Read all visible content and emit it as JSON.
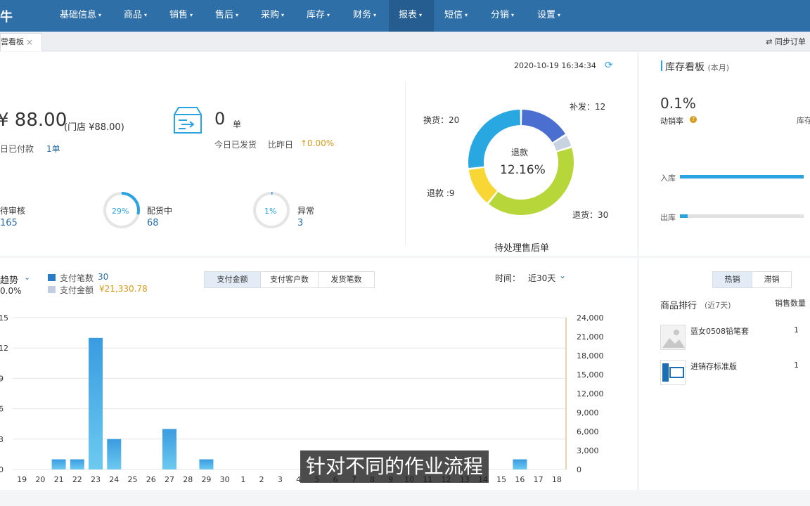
{
  "nav": {
    "logo": "牛",
    "items": [
      "基础信息",
      "商品",
      "销售",
      "售后",
      "采购",
      "库存",
      "财务",
      "报表",
      "短信",
      "分销",
      "设置"
    ],
    "active": "报表"
  },
  "tabbar": {
    "tab_label": "营看板",
    "close": "×",
    "sync_label": "同步订单"
  },
  "overview": {
    "timestamp": "2020-10-19 16:34:34",
    "paid_amount": "¥ 88.00",
    "paid_amount_sub": "(门店 ¥88.00)",
    "paid_today_label": "日已付款",
    "paid_today_count": "1单",
    "shipped_count": "0",
    "shipped_unit": "单",
    "shipped_label": "今日已发货",
    "compare_label": "比昨日",
    "compare_value": "↑0.00%",
    "pending_review_label": "待审核",
    "pending_review_value": "165",
    "allocating_pct": "29%",
    "allocating_label": "配货中",
    "allocating_value": "68",
    "exception_pct": "1%",
    "exception_label": "异常",
    "exception_value": "3"
  },
  "after_sales": {
    "title": "待处理售后单",
    "center_label": "退款",
    "center_value": "12.16%",
    "labels": {
      "exchange": "换货：20",
      "resend": "补发：12",
      "return": "退货：30",
      "refund": "退款 :9"
    },
    "colors": {
      "exchange": "#29a7e1",
      "resend": "#4a6fd0",
      "return": "#b7d63a",
      "refund": "#f8d633",
      "other": "#c8d3e0"
    },
    "values": {
      "exchange": 20,
      "resend": 12,
      "other": 3,
      "return": 30,
      "refund": 9
    }
  },
  "trend": {
    "title": "趋势",
    "pct": "0.0%",
    "legend": [
      {
        "label": "支付笔数",
        "value": "30",
        "color": "#2a7bc5"
      },
      {
        "label": "支付金额",
        "value": "¥21,330.78",
        "color": "#c1cde0"
      }
    ],
    "tabs": [
      "支付金额",
      "支付客户数",
      "发货笔数"
    ],
    "active_tab": "支付金额",
    "time_label": "时间：",
    "time_value": "近30天"
  },
  "chart_data": {
    "type": "bar",
    "categories": [
      "19",
      "20",
      "21",
      "22",
      "23",
      "24",
      "25",
      "26",
      "27",
      "28",
      "29",
      "30",
      "1",
      "2",
      "3",
      "4",
      "5",
      "6",
      "7",
      "8",
      "9",
      "10",
      "11",
      "12",
      "13",
      "14",
      "15",
      "16",
      "17",
      "18"
    ],
    "series": [
      {
        "values": [
          0,
          0,
          1,
          1,
          13,
          3,
          0,
          0,
          4,
          0,
          1,
          0,
          0,
          0,
          0,
          0,
          0,
          0,
          0,
          0,
          0,
          0,
          0,
          0,
          0,
          0,
          0,
          1,
          0,
          0
        ]
      },
      {
        "values": [
          0,
          0,
          0,
          0,
          0,
          0,
          0,
          0,
          0,
          0,
          0,
          0,
          0,
          0,
          0,
          0,
          0,
          0,
          0,
          0,
          0,
          0,
          0,
          0,
          0,
          0,
          0,
          0,
          0,
          0
        ]
      }
    ],
    "left_ticks": [
      "15",
      "12",
      "9",
      "6",
      "3",
      "0"
    ],
    "right_ticks": [
      "24,000",
      "21,000",
      "18,000",
      "15,000",
      "12,000",
      "9,000",
      "6,000",
      "3,000",
      "0"
    ],
    "ylim_left": [
      0,
      15
    ],
    "ylim_right": [
      0,
      24000
    ],
    "grid": true
  },
  "inventory": {
    "title": "库存看板",
    "scope": "(本月)",
    "turnover": "0.1%",
    "turnover_label": "动销率",
    "help": "?",
    "stock_label": "库存",
    "in_label": "入库",
    "in_ratio": 1.0,
    "out_label": "出库",
    "out_ratio": 0.06
  },
  "ranking": {
    "tabs": [
      "热销",
      "滞销"
    ],
    "active_tab": "热销",
    "title": "商品排行",
    "range": "(近7天)",
    "col_header": "销售数量",
    "items": [
      {
        "name": "蓝女0508铅笔套",
        "qty": "1"
      },
      {
        "name": "进销存标准版",
        "qty": "1"
      }
    ]
  },
  "subtitle": "针对不同的作业流程"
}
